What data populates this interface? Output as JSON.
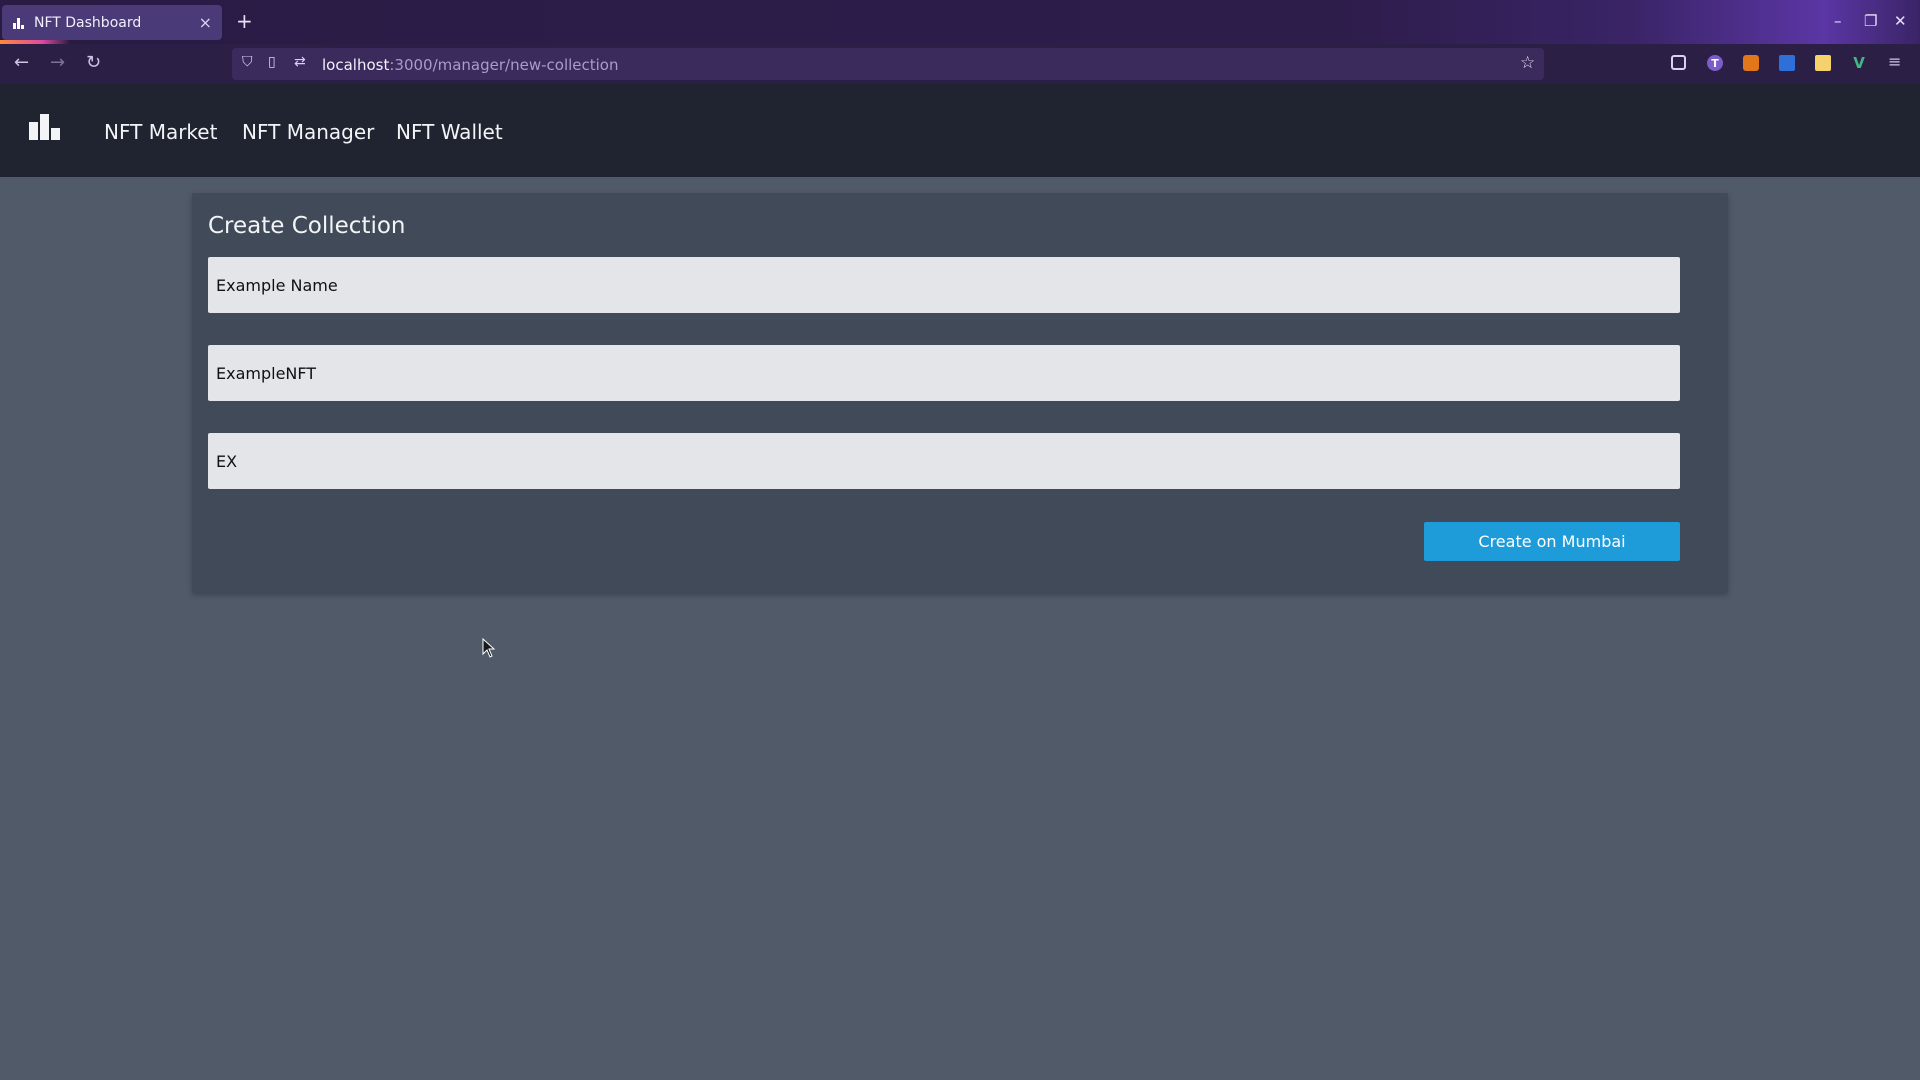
{
  "browser": {
    "tab_title": "NFT Dashboard",
    "tab_close": "×",
    "new_tab": "+",
    "url_host": "localhost",
    "url_path": ":3000/manager/new-collection",
    "window_controls": {
      "minimize": "–",
      "restore": "❐",
      "close": "✕"
    },
    "extensions": [
      {
        "name": "pocket-icon",
        "label": ""
      },
      {
        "name": "extension-t-icon",
        "label": "T"
      },
      {
        "name": "metamask-icon",
        "label": ""
      },
      {
        "name": "extension-bookmark-icon",
        "label": ""
      },
      {
        "name": "extension-clock-icon",
        "label": ""
      },
      {
        "name": "vue-devtools-icon",
        "label": "V"
      }
    ]
  },
  "app": {
    "nav": [
      "NFT Market",
      "NFT Manager",
      "NFT Wallet"
    ]
  },
  "form": {
    "title": "Create Collection",
    "fields": {
      "collection_name": "Example Name",
      "token_name": "ExampleNFT",
      "symbol": "EX"
    },
    "submit_label": "Create on Mumbai"
  },
  "colors": {
    "page_bg": "#515a69",
    "header_bg": "#1f2430",
    "card_bg": "#414a58",
    "input_bg": "#e4e5e9",
    "button_bg": "#1e9bd9",
    "browser_bg": "#2b1f45"
  }
}
